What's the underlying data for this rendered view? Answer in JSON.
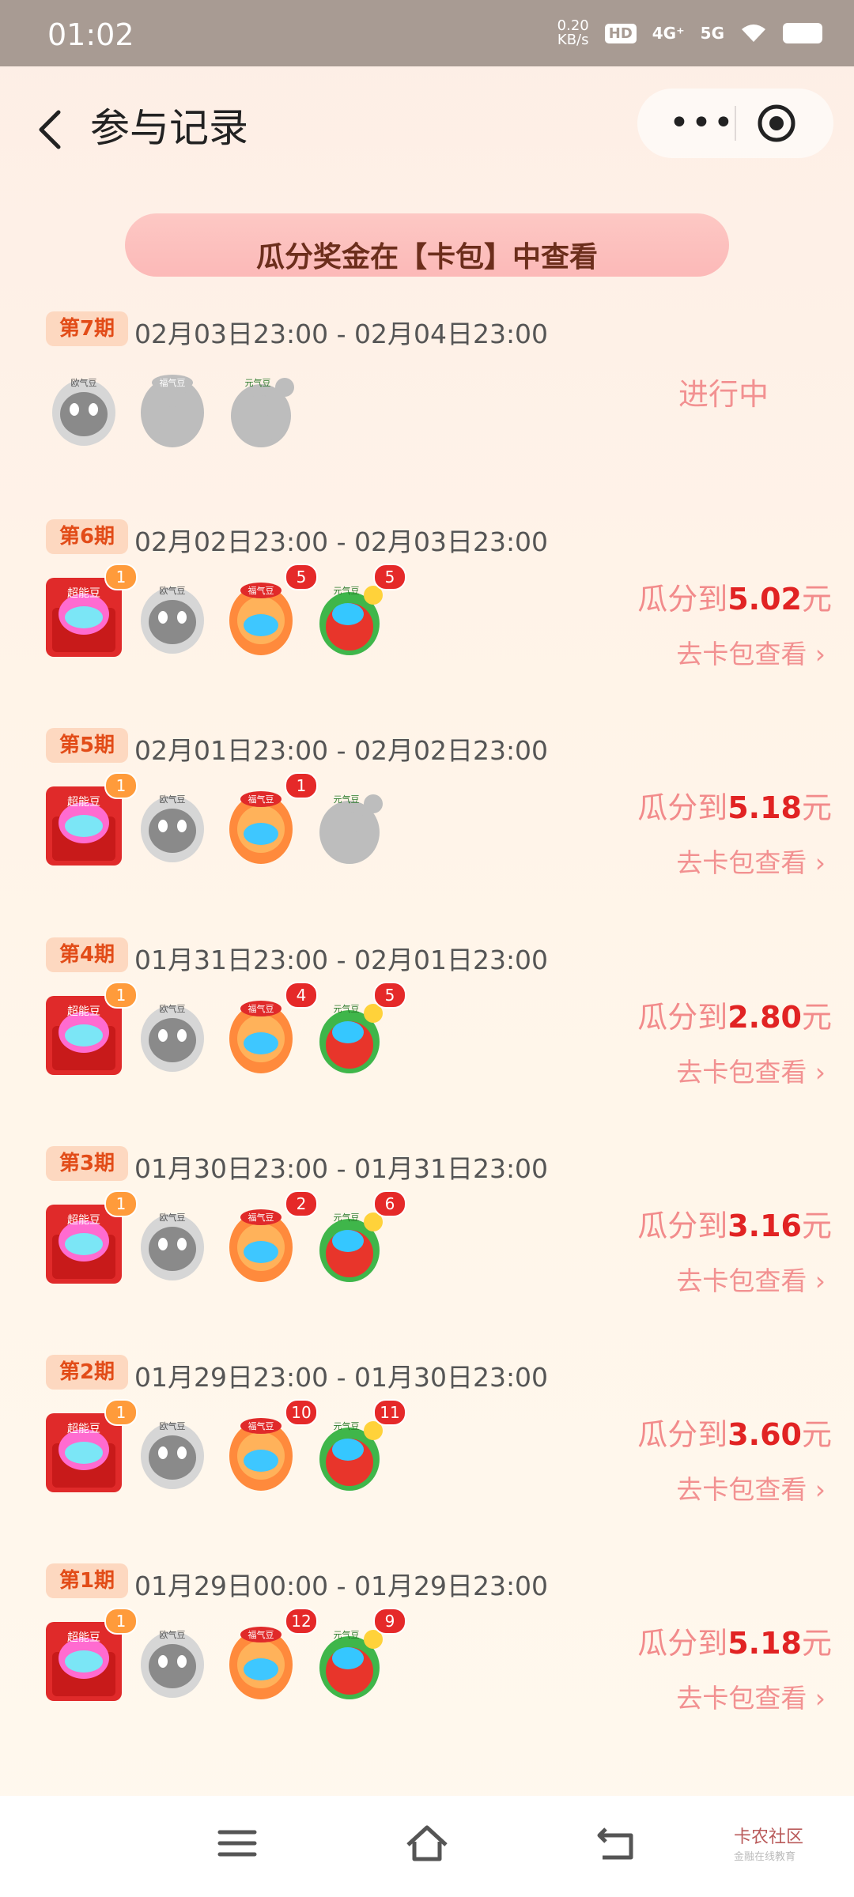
{
  "status": {
    "time": "01:02",
    "speed_top": "0.20",
    "speed_bottom": "KB/s",
    "hd": "HD",
    "net1": "4G⁺",
    "net2": "5G"
  },
  "header": {
    "title": "参与记录"
  },
  "banner": {
    "text": "瓜分奖金在【卡包】中查看"
  },
  "periods": [
    {
      "tag": "第7期",
      "range": "02月03日23:00 - 02月04日23:00",
      "status": "进行中",
      "badges": []
    },
    {
      "tag": "第6期",
      "range": "02月02日23:00 - 02月03日23:00",
      "prefix": "瓜分到",
      "amount": "5.02",
      "unit": "元",
      "link": "去卡包查看 ›",
      "badges": [
        "1",
        "5",
        "5"
      ]
    },
    {
      "tag": "第5期",
      "range": "02月01日23:00 - 02月02日23:00",
      "prefix": "瓜分到",
      "amount": "5.18",
      "unit": "元",
      "link": "去卡包查看 ›",
      "badges": [
        "1",
        "1"
      ]
    },
    {
      "tag": "第4期",
      "range": "01月31日23:00 - 02月01日23:00",
      "prefix": "瓜分到",
      "amount": "2.80",
      "unit": "元",
      "link": "去卡包查看 ›",
      "badges": [
        "1",
        "4",
        "5"
      ]
    },
    {
      "tag": "第3期",
      "range": "01月30日23:00 - 01月31日23:00",
      "prefix": "瓜分到",
      "amount": "3.16",
      "unit": "元",
      "link": "去卡包查看 ›",
      "badges": [
        "1",
        "2",
        "6"
      ]
    },
    {
      "tag": "第2期",
      "range": "01月29日23:00 - 01月30日23:00",
      "prefix": "瓜分到",
      "amount": "3.60",
      "unit": "元",
      "link": "去卡包查看 ›",
      "badges": [
        "1",
        "10",
        "11"
      ]
    },
    {
      "tag": "第1期",
      "range": "01月29日00:00 - 01月29日23:00",
      "prefix": "瓜分到",
      "amount": "5.18",
      "unit": "元",
      "link": "去卡包查看 ›",
      "badges": [
        "1",
        "12",
        "9"
      ]
    }
  ],
  "icon_labels": {
    "super": "超能豆",
    "ouqi": "欧气豆",
    "fuqi": "福气豆",
    "yuanqi": "元气豆"
  },
  "brand": {
    "name": "卡农社区",
    "sub": "金融在线教育"
  },
  "colors": {
    "accent": "#e12323",
    "link": "#f29191",
    "tag_bg": "#fdd8c0",
    "tag_text": "#e24c18"
  }
}
